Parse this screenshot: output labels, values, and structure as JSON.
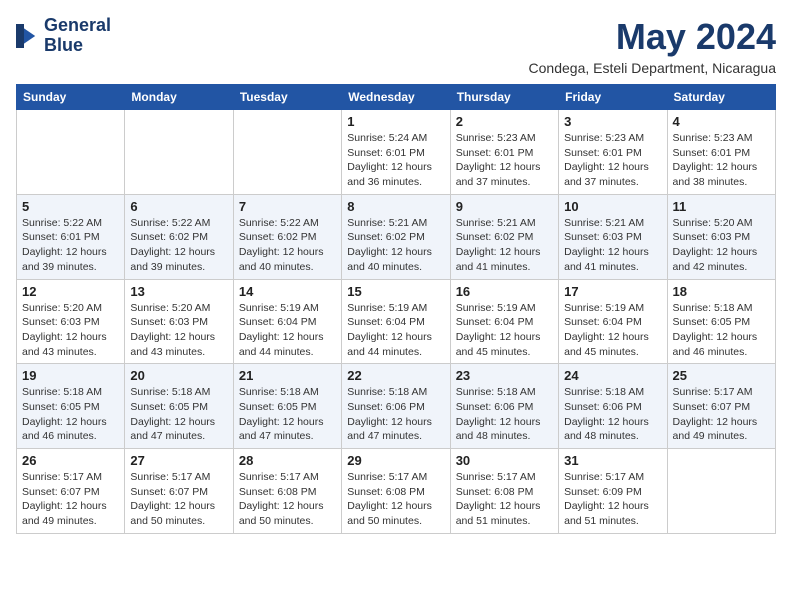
{
  "logo": {
    "line1": "General",
    "line2": "Blue"
  },
  "title": "May 2024",
  "subtitle": "Condega, Esteli Department, Nicaragua",
  "days_header": [
    "Sunday",
    "Monday",
    "Tuesday",
    "Wednesday",
    "Thursday",
    "Friday",
    "Saturday"
  ],
  "weeks": [
    [
      {
        "day": "",
        "info": ""
      },
      {
        "day": "",
        "info": ""
      },
      {
        "day": "",
        "info": ""
      },
      {
        "day": "1",
        "info": "Sunrise: 5:24 AM\nSunset: 6:01 PM\nDaylight: 12 hours\nand 36 minutes."
      },
      {
        "day": "2",
        "info": "Sunrise: 5:23 AM\nSunset: 6:01 PM\nDaylight: 12 hours\nand 37 minutes."
      },
      {
        "day": "3",
        "info": "Sunrise: 5:23 AM\nSunset: 6:01 PM\nDaylight: 12 hours\nand 37 minutes."
      },
      {
        "day": "4",
        "info": "Sunrise: 5:23 AM\nSunset: 6:01 PM\nDaylight: 12 hours\nand 38 minutes."
      }
    ],
    [
      {
        "day": "5",
        "info": "Sunrise: 5:22 AM\nSunset: 6:01 PM\nDaylight: 12 hours\nand 39 minutes."
      },
      {
        "day": "6",
        "info": "Sunrise: 5:22 AM\nSunset: 6:02 PM\nDaylight: 12 hours\nand 39 minutes."
      },
      {
        "day": "7",
        "info": "Sunrise: 5:22 AM\nSunset: 6:02 PM\nDaylight: 12 hours\nand 40 minutes."
      },
      {
        "day": "8",
        "info": "Sunrise: 5:21 AM\nSunset: 6:02 PM\nDaylight: 12 hours\nand 40 minutes."
      },
      {
        "day": "9",
        "info": "Sunrise: 5:21 AM\nSunset: 6:02 PM\nDaylight: 12 hours\nand 41 minutes."
      },
      {
        "day": "10",
        "info": "Sunrise: 5:21 AM\nSunset: 6:03 PM\nDaylight: 12 hours\nand 41 minutes."
      },
      {
        "day": "11",
        "info": "Sunrise: 5:20 AM\nSunset: 6:03 PM\nDaylight: 12 hours\nand 42 minutes."
      }
    ],
    [
      {
        "day": "12",
        "info": "Sunrise: 5:20 AM\nSunset: 6:03 PM\nDaylight: 12 hours\nand 43 minutes."
      },
      {
        "day": "13",
        "info": "Sunrise: 5:20 AM\nSunset: 6:03 PM\nDaylight: 12 hours\nand 43 minutes."
      },
      {
        "day": "14",
        "info": "Sunrise: 5:19 AM\nSunset: 6:04 PM\nDaylight: 12 hours\nand 44 minutes."
      },
      {
        "day": "15",
        "info": "Sunrise: 5:19 AM\nSunset: 6:04 PM\nDaylight: 12 hours\nand 44 minutes."
      },
      {
        "day": "16",
        "info": "Sunrise: 5:19 AM\nSunset: 6:04 PM\nDaylight: 12 hours\nand 45 minutes."
      },
      {
        "day": "17",
        "info": "Sunrise: 5:19 AM\nSunset: 6:04 PM\nDaylight: 12 hours\nand 45 minutes."
      },
      {
        "day": "18",
        "info": "Sunrise: 5:18 AM\nSunset: 6:05 PM\nDaylight: 12 hours\nand 46 minutes."
      }
    ],
    [
      {
        "day": "19",
        "info": "Sunrise: 5:18 AM\nSunset: 6:05 PM\nDaylight: 12 hours\nand 46 minutes."
      },
      {
        "day": "20",
        "info": "Sunrise: 5:18 AM\nSunset: 6:05 PM\nDaylight: 12 hours\nand 47 minutes."
      },
      {
        "day": "21",
        "info": "Sunrise: 5:18 AM\nSunset: 6:05 PM\nDaylight: 12 hours\nand 47 minutes."
      },
      {
        "day": "22",
        "info": "Sunrise: 5:18 AM\nSunset: 6:06 PM\nDaylight: 12 hours\nand 47 minutes."
      },
      {
        "day": "23",
        "info": "Sunrise: 5:18 AM\nSunset: 6:06 PM\nDaylight: 12 hours\nand 48 minutes."
      },
      {
        "day": "24",
        "info": "Sunrise: 5:18 AM\nSunset: 6:06 PM\nDaylight: 12 hours\nand 48 minutes."
      },
      {
        "day": "25",
        "info": "Sunrise: 5:17 AM\nSunset: 6:07 PM\nDaylight: 12 hours\nand 49 minutes."
      }
    ],
    [
      {
        "day": "26",
        "info": "Sunrise: 5:17 AM\nSunset: 6:07 PM\nDaylight: 12 hours\nand 49 minutes."
      },
      {
        "day": "27",
        "info": "Sunrise: 5:17 AM\nSunset: 6:07 PM\nDaylight: 12 hours\nand 50 minutes."
      },
      {
        "day": "28",
        "info": "Sunrise: 5:17 AM\nSunset: 6:08 PM\nDaylight: 12 hours\nand 50 minutes."
      },
      {
        "day": "29",
        "info": "Sunrise: 5:17 AM\nSunset: 6:08 PM\nDaylight: 12 hours\nand 50 minutes."
      },
      {
        "day": "30",
        "info": "Sunrise: 5:17 AM\nSunset: 6:08 PM\nDaylight: 12 hours\nand 51 minutes."
      },
      {
        "day": "31",
        "info": "Sunrise: 5:17 AM\nSunset: 6:09 PM\nDaylight: 12 hours\nand 51 minutes."
      },
      {
        "day": "",
        "info": ""
      }
    ]
  ]
}
